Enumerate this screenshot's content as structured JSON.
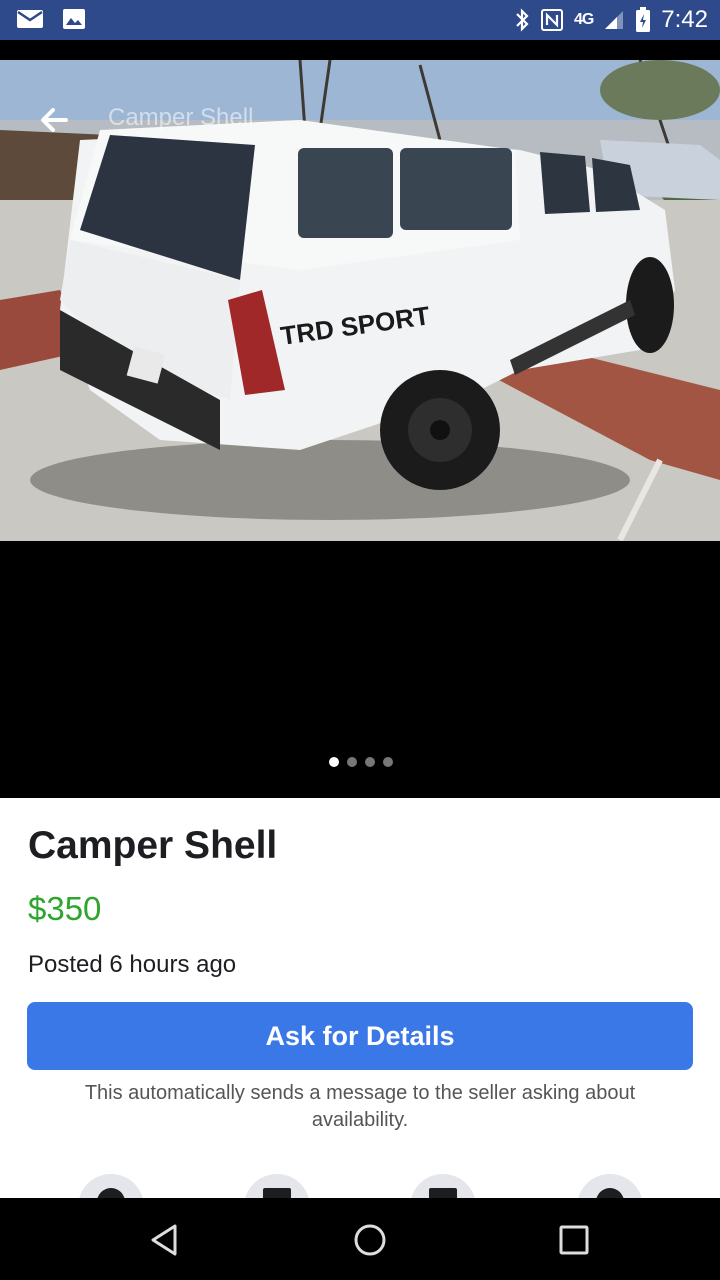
{
  "status_bar": {
    "time": "7:42",
    "network": "4G"
  },
  "listing": {
    "header_title": "Camper Shell",
    "title": "Camper Shell",
    "price": "$350",
    "posted": "Posted 6 hours ago",
    "primary_action": "Ask for Details",
    "note": "This automatically sends a message to the seller asking about availability.",
    "photo_count": 4,
    "current_photo": 1,
    "decal_text": "TRD SPORT"
  },
  "colors": {
    "status_bar": "#2f4a8a",
    "button": "#3b78e7",
    "price": "#2ea52e"
  }
}
